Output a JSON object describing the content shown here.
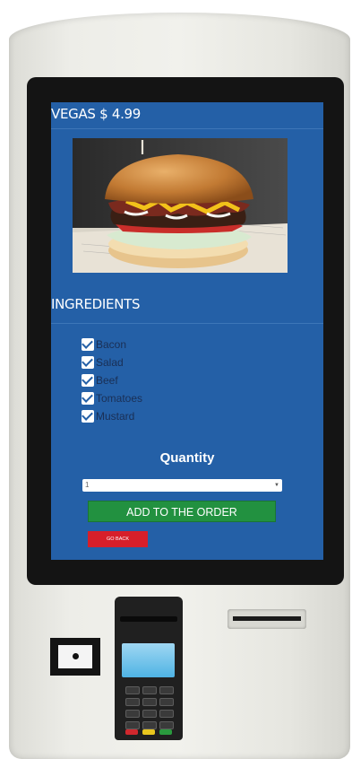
{
  "product": {
    "title": "VEGAS $ 4.99"
  },
  "ingredients": {
    "heading": "INGREDIENTS",
    "items": [
      {
        "label": "Bacon",
        "checked": true
      },
      {
        "label": "Salad",
        "checked": true
      },
      {
        "label": "Beef",
        "checked": true
      },
      {
        "label": "Tomatoes",
        "checked": true
      },
      {
        "label": "Mustard",
        "checked": true
      }
    ]
  },
  "quantity": {
    "label": "Quantity",
    "selected": "1"
  },
  "actions": {
    "add_label": "ADD TO THE ORDER",
    "back_label": "GO BACK"
  },
  "colors": {
    "screen_bg": "#2460a7",
    "add_button": "#229140",
    "back_button": "#d71f2a"
  }
}
